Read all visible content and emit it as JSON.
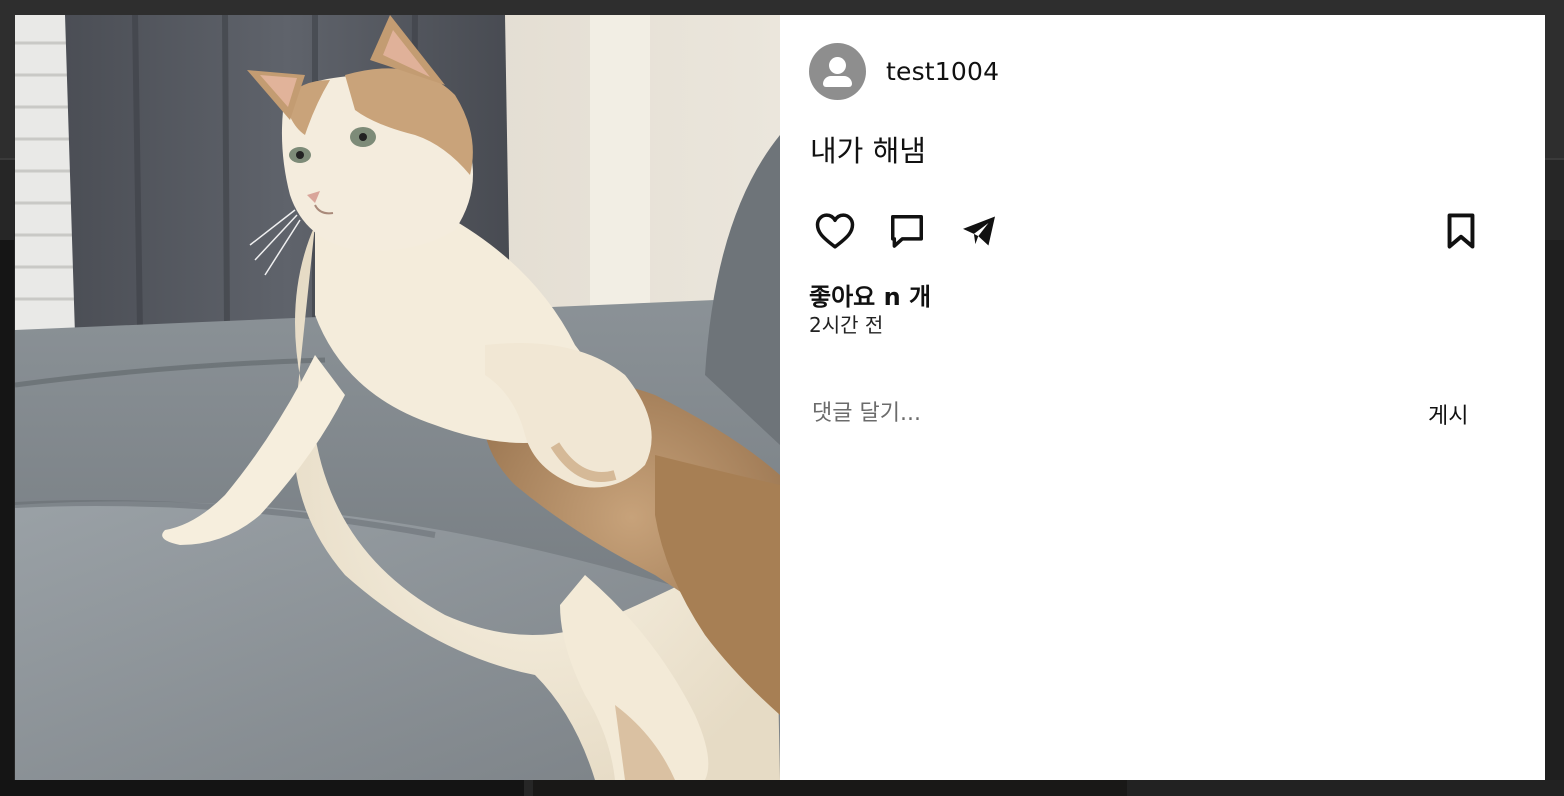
{
  "post": {
    "username": "test1004",
    "caption": "내가 해냄",
    "likes_text": "좋아요 n 개",
    "time_ago": "2시간 전",
    "photo_alt": "photo-cat"
  },
  "comment": {
    "placeholder": "댓글 달기...",
    "submit_label": "게시"
  },
  "icons": {
    "avatar": "user-avatar-icon",
    "like": "heart-icon",
    "comment": "comment-icon",
    "share": "paper-plane-icon",
    "save": "bookmark-icon"
  },
  "colors": {
    "backdrop": "#262626",
    "panel": "#ffffff",
    "avatar": "#8e8e8e",
    "text": "#111111",
    "placeholder": "#6b6b6b"
  }
}
